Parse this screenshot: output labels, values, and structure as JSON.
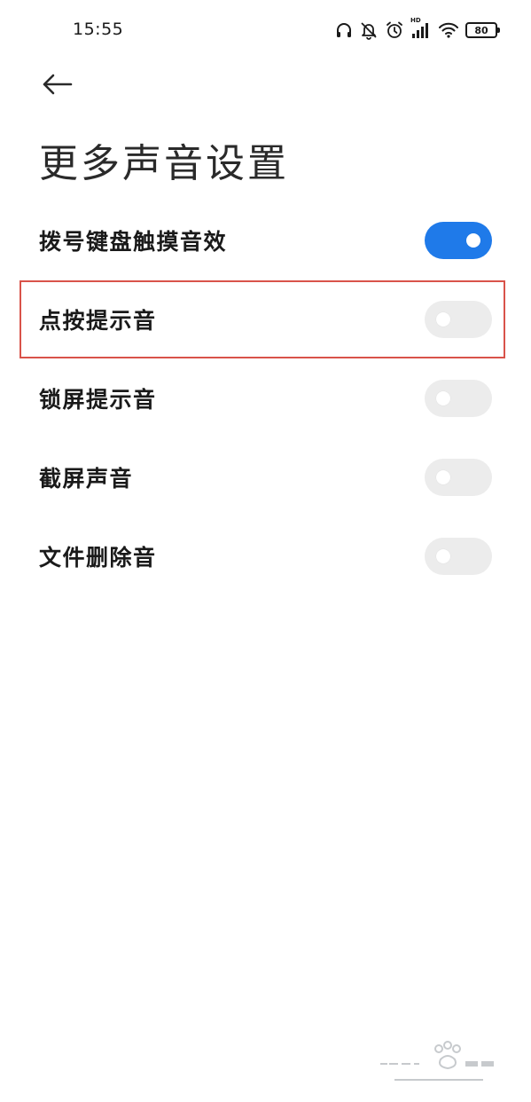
{
  "status_bar": {
    "time": "15:55",
    "icons": [
      "headphones-icon",
      "bell-muted-icon",
      "alarm-icon",
      "hd-signal-icon",
      "wifi-icon",
      "battery-icon"
    ],
    "hd_label": "HD",
    "battery_level": "80"
  },
  "header": {
    "back_icon": "arrow-left-icon",
    "title": "更多声音设置"
  },
  "settings": [
    {
      "label": "拨号键盘触摸音效",
      "enabled": true
    },
    {
      "label": "点按提示音",
      "enabled": false
    },
    {
      "label": "锁屏提示音",
      "enabled": false
    },
    {
      "label": "截屏声音",
      "enabled": false
    },
    {
      "label": "文件删除音",
      "enabled": false
    }
  ],
  "colors": {
    "toggle_on": "#1f7ae9",
    "toggle_off": "#ececec",
    "highlight": "#d9534a"
  }
}
